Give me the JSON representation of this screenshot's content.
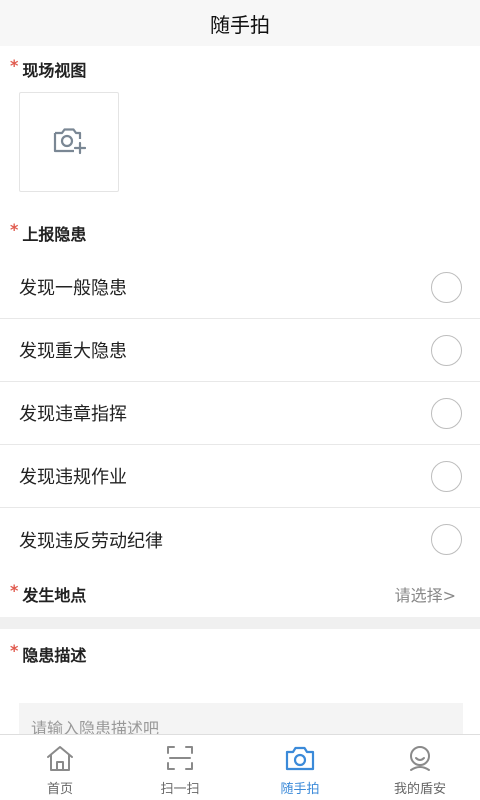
{
  "header": {
    "title": "随手拍"
  },
  "scene_view": {
    "required_mark": "*",
    "title": "现场视图",
    "icon": "camera-add-icon"
  },
  "report": {
    "required_mark": "*",
    "title": "上报隐患",
    "options": [
      {
        "label": "发现一般隐患",
        "selected": false
      },
      {
        "label": "发现重大隐患",
        "selected": false
      },
      {
        "label": "发现违章指挥",
        "selected": false
      },
      {
        "label": "发现违规作业",
        "selected": false
      },
      {
        "label": "发现违反劳动纪律",
        "selected": false
      }
    ]
  },
  "location": {
    "required_mark": "*",
    "title": "发生地点",
    "value": "请选择>"
  },
  "description": {
    "required_mark": "*",
    "title": "隐患描述",
    "placeholder": "请输入隐患描述吧"
  },
  "tabbar": {
    "active_color": "#3b8ad9",
    "items": [
      {
        "label": "首页",
        "icon": "home-icon",
        "active": false
      },
      {
        "label": "扫一扫",
        "icon": "scan-icon",
        "active": false
      },
      {
        "label": "随手拍",
        "icon": "camera-icon",
        "active": true
      },
      {
        "label": "我的盾安",
        "icon": "profile-icon",
        "active": false
      }
    ]
  }
}
